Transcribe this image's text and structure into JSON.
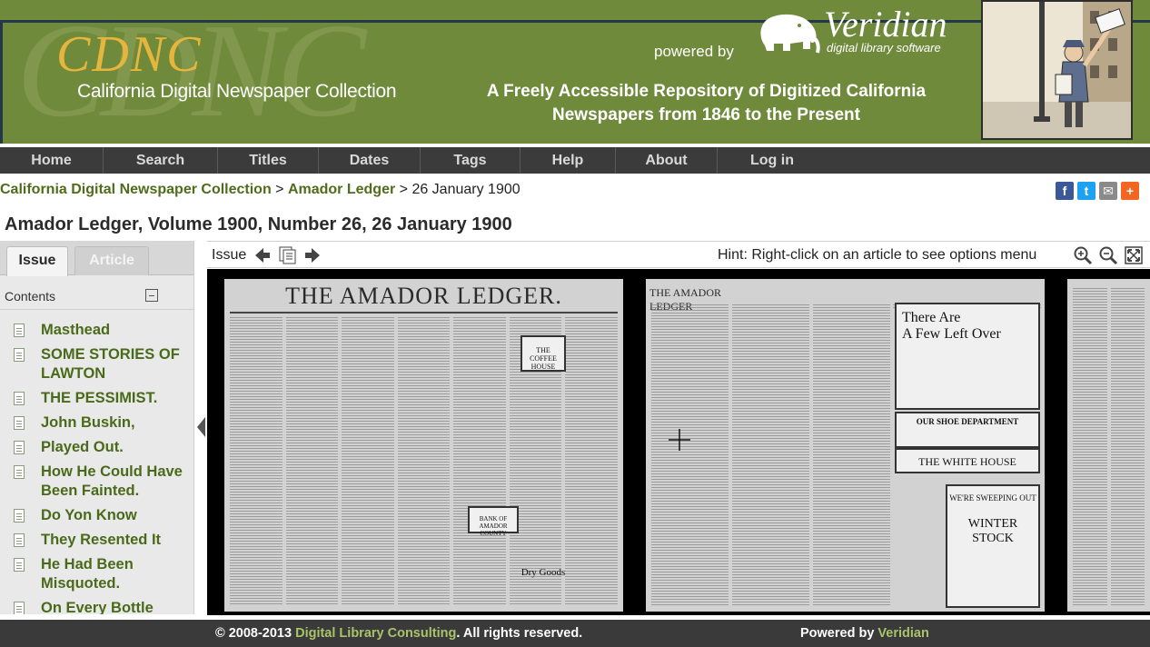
{
  "header": {
    "watermark": "CDNC",
    "logo_text": "CDNC",
    "site_title": "California Digital Newspaper Collection",
    "powered_by": "powered by",
    "veridian_name": "Veridian",
    "veridian_tagline": "digital library software",
    "tagline_line1": "A Freely Accessible Repository of Digitized California",
    "tagline_line2": "Newspapers from 1846 to the Present"
  },
  "nav": {
    "items": [
      {
        "label": "Home"
      },
      {
        "label": "Search"
      },
      {
        "label": "Titles"
      },
      {
        "label": "Dates"
      },
      {
        "label": "Tags"
      },
      {
        "label": "Help"
      },
      {
        "label": "About"
      },
      {
        "label": "Log in"
      }
    ]
  },
  "breadcrumb": {
    "root": "California Digital Newspaper Collection",
    "sep1": " > ",
    "title": "Amador Ledger",
    "sep2": " > ",
    "current": "26 January 1900"
  },
  "share": {
    "facebook": "f",
    "twitter": "t",
    "email": "✉",
    "more": "+",
    "colors": {
      "facebook": "#3b5998",
      "twitter": "#1da1f2",
      "email": "#8a8a8a",
      "more": "#f26522"
    }
  },
  "page_title": "Amador Ledger, Volume 1900, Number 26, 26 January 1900",
  "sidebar": {
    "tabs": {
      "issue": "Issue",
      "article": "Article"
    },
    "contents_label": "Contents",
    "toc": [
      "Masthead",
      "SOME STORIES OF LAWTON",
      "THE PESSIMIST.",
      "John Buskin,",
      "Played Out.",
      "How He Could Have Been Fainted.",
      "Do Yon Know",
      "They Resented It",
      "He Had Been Misquoted.",
      "On Every Bottle"
    ]
  },
  "viewer": {
    "issue_label": "Issue",
    "hint": "Hint: Right-click on an article to see options menu",
    "page1_masthead": "THE AMADOR LEDGER.",
    "page2_masthead": "THE AMADOR LEDGER",
    "ad_left_over_1": "There Are",
    "ad_left_over_2": "A Few Left Over",
    "ad_white_house": "THE WHITE HOUSE",
    "ad_shoe": "OUR SHOE DEPARTMENT",
    "ad_sweeping_1": "WE'RE SWEEPING OUT",
    "ad_sweeping_2": "WINTER STOCK",
    "ad_coffee": "THE COFFEE HOUSE",
    "ad_dry_goods": "Dry Goods",
    "ad_bank": "BANK OF AMADOR COUNTY"
  },
  "footer": {
    "copyright_prefix": "© 2008-2013 ",
    "copyright_company": "Digital Library Consulting",
    "copyright_suffix": ". All rights reserved.",
    "powered_prefix": "Powered by ",
    "powered_name": "Veridian"
  },
  "colors": {
    "header_green": "#6f8a3b",
    "logo_gold": "#e6b53c",
    "nav_bg": "#3b3b3b",
    "link_green": "#506b1c",
    "toc_green": "#4a6a1a",
    "footer_bg": "#3a3a3a"
  }
}
